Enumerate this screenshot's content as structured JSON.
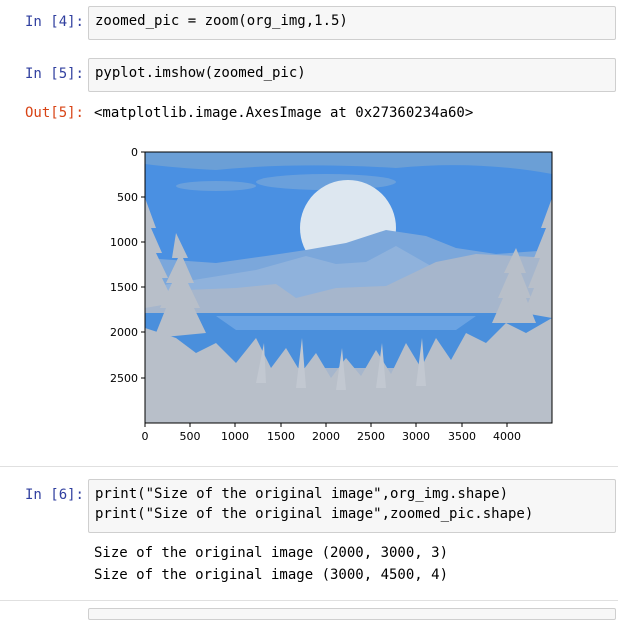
{
  "cells": [
    {
      "prompt": "In [4]:",
      "code": [
        "zoomed_pic = zoom(org_img,1.5)"
      ]
    },
    {
      "prompt": "In [5]:",
      "code": [
        "pyplot.imshow(zoomed_pic)"
      ],
      "out_prompt": "Out[5]:",
      "output": "<matplotlib.image.AxesImage at 0x27360234a60>"
    },
    {
      "prompt": "In [6]:",
      "code": [
        "print(\"Size of the original image\",org_img.shape)",
        "print(\"Size of the original image\",zoomed_pic.shape)"
      ],
      "output_lines": [
        "Size of the original image (2000, 3000, 3)",
        "Size of the original image (3000, 4500, 4)"
      ]
    }
  ],
  "plot": {
    "xticks": [
      "0",
      "500",
      "1000",
      "1500",
      "2000",
      "2500",
      "3000",
      "3500",
      "4000"
    ],
    "yticks": [
      "0",
      "500",
      "1000",
      "1500",
      "2000",
      "2500"
    ],
    "xlim": [
      0,
      4500
    ],
    "ylim": [
      3000,
      0
    ],
    "colors": {
      "sky": "#4a90e2",
      "land": "#b8bfc9",
      "moon": "#dde7f0",
      "water": "#4a8fdc"
    }
  }
}
